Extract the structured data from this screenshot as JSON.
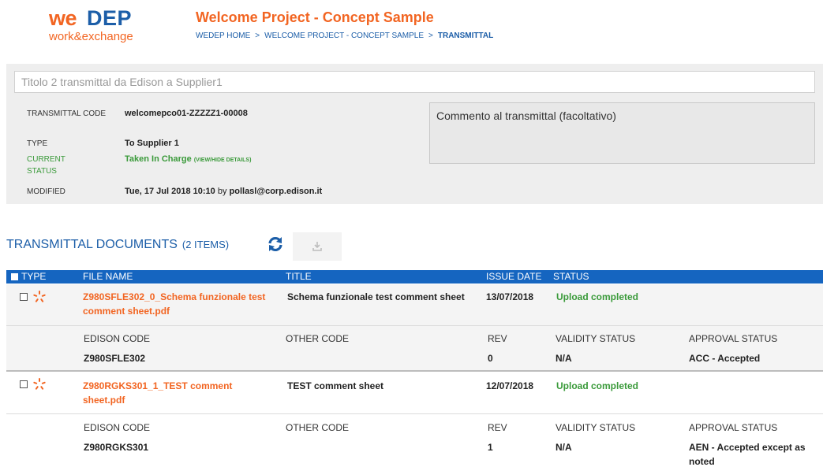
{
  "logo": {
    "we": "we",
    "dep": "DEP",
    "sub": "work&exchange"
  },
  "header": {
    "project_title": "Welcome Project - Concept Sample",
    "breadcrumb": [
      "WEDEP HOME",
      "WELCOME PROJECT - CONCEPT SAMPLE",
      "TRANSMITTAL"
    ],
    "breadcrumb_sep": ">"
  },
  "transmittal": {
    "title_value": "Titolo 2 transmittal da Edison a Supplier1",
    "fields": {
      "code_label": "TRANSMITTAL CODE",
      "code_value": "welcomepco01-ZZZZZ1-00008",
      "type_label": "TYPE",
      "type_value": "To Supplier 1",
      "status_label": "CURRENT STATUS",
      "status_value": "Taken In Charge",
      "status_link": "(VIEW/HIDE DETAILS)",
      "modified_label": "MODIFIED",
      "modified_value": "Tue, 17 Jul 2018 10:10",
      "modified_by": "by",
      "modified_user": "pollasl@corp.edison.it"
    },
    "comment_placeholder": "Commento al transmittal (facoltativo)"
  },
  "documents": {
    "title": "TRANSMITTAL DOCUMENTS",
    "count": "(2 ITEMS)",
    "columns": [
      "TYPE",
      "FILE NAME",
      "TITLE",
      "ISSUE DATE",
      "STATUS"
    ],
    "sub_columns": [
      "EDISON CODE",
      "OTHER CODE",
      "REV",
      "VALIDITY STATUS",
      "APPROVAL STATUS"
    ],
    "rows": [
      {
        "file_name": "Z980SFLE302_0_Schema funzionale test comment sheet.pdf",
        "title": "Schema funzionale test comment sheet",
        "issue_date": "13/07/2018",
        "status": "Upload completed",
        "edison_code": "Z980SFLE302",
        "other_code": "",
        "rev": "0",
        "validity": "N/A",
        "approval": "ACC - Accepted"
      },
      {
        "file_name": "Z980RGKS301_1_TEST comment sheet.pdf",
        "title": "TEST comment sheet",
        "issue_date": "12/07/2018",
        "status": "Upload completed",
        "edison_code": "Z980RGKS301",
        "other_code": "",
        "rev": "1",
        "validity": "N/A",
        "approval": "AEN - Accepted except as noted"
      }
    ]
  },
  "colors": {
    "brand_orange": "#f26522",
    "brand_blue": "#1c5ea8",
    "header_bar": "#1565c0",
    "status_green": "#3a9a3a"
  },
  "icons": [
    "refresh-icon",
    "download-icon",
    "edison-file-type-icon"
  ]
}
